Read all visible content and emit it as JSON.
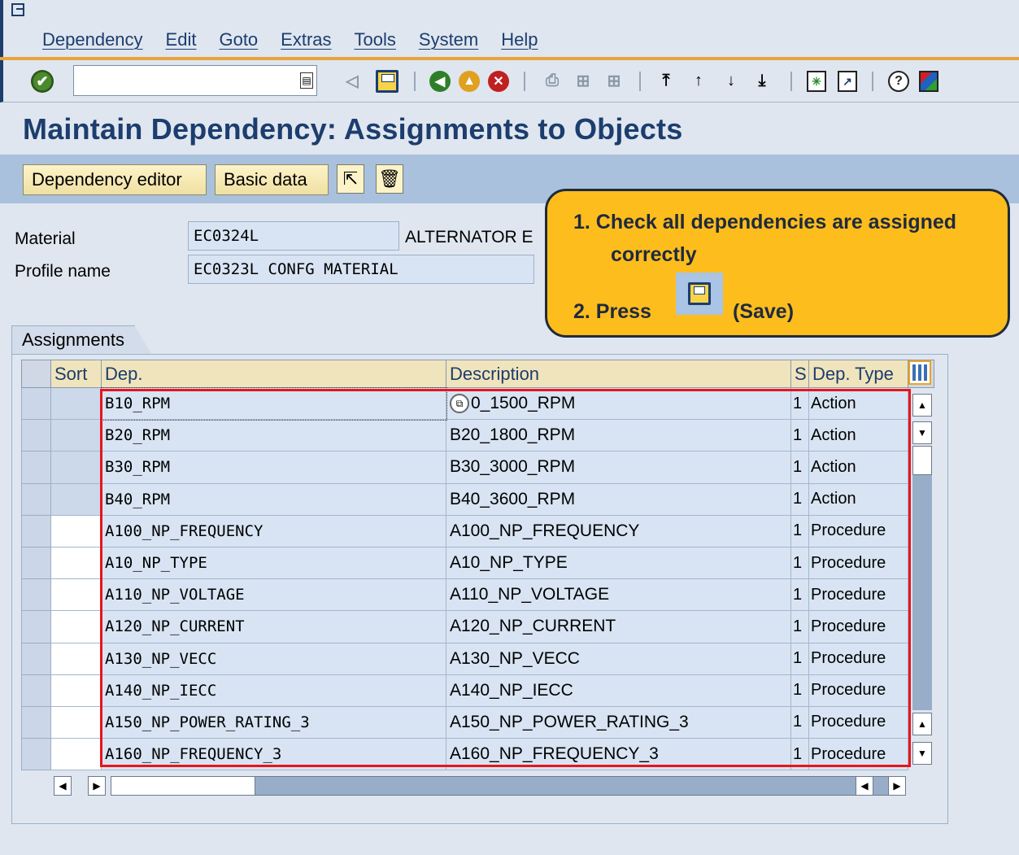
{
  "menu": [
    "Dependency",
    "Edit",
    "Goto",
    "Extras",
    "Tools",
    "System",
    "Help"
  ],
  "toolbar": {
    "command_value": "",
    "icons": [
      "enter-icon",
      "back-icon",
      "save-icon",
      "back-green-icon",
      "exit-icon",
      "cancel-icon",
      "print-icon",
      "find-icon",
      "find-next-icon",
      "first-page-icon",
      "previous-page-icon",
      "next-page-icon",
      "last-page-icon",
      "create-session-icon",
      "shortcut-icon",
      "help-icon",
      "customize-layout-icon"
    ]
  },
  "page_title": "Maintain Dependency: Assignments to Objects",
  "app_toolbar": {
    "dependency_editor": "Dependency editor",
    "basic_data": "Basic data"
  },
  "header": {
    "material_label": "Material",
    "material_value": "EC0324L",
    "material_desc": "ALTERNATOR E",
    "profile_label": "Profile name",
    "profile_value": "EC0323L CONFG MATERIAL"
  },
  "callout": {
    "step1_line1": "1. Check all dependencies are assigned",
    "step1_line2": "correctly",
    "step2_prefix": "2. Press",
    "step2_suffix": "(Save)"
  },
  "assignments": {
    "tab_label": "Assignments",
    "columns": {
      "sort": "Sort",
      "dep": "Dep.",
      "description": "Description",
      "s": "S",
      "dep_type": "Dep. Type"
    },
    "rows": [
      {
        "dep": "B10_RPM",
        "description": "0_1500_RPM",
        "s": "1",
        "type": "Action"
      },
      {
        "dep": "B20_RPM",
        "description": "B20_1800_RPM",
        "s": "1",
        "type": "Action"
      },
      {
        "dep": "B30_RPM",
        "description": "B30_3000_RPM",
        "s": "1",
        "type": "Action"
      },
      {
        "dep": "B40_RPM",
        "description": "B40_3600_RPM",
        "s": "1",
        "type": "Action"
      },
      {
        "dep": "A100_NP_FREQUENCY",
        "description": "A100_NP_FREQUENCY",
        "s": "1",
        "type": "Procedure"
      },
      {
        "dep": "A10_NP_TYPE",
        "description": "A10_NP_TYPE",
        "s": "1",
        "type": "Procedure"
      },
      {
        "dep": "A110_NP_VOLTAGE",
        "description": "A110_NP_VOLTAGE",
        "s": "1",
        "type": "Procedure"
      },
      {
        "dep": "A120_NP_CURRENT",
        "description": "A120_NP_CURRENT",
        "s": "1",
        "type": "Procedure"
      },
      {
        "dep": "A130_NP_VECC",
        "description": "A130_NP_VECC",
        "s": "1",
        "type": "Procedure"
      },
      {
        "dep": "A140_NP_IECC",
        "description": "A140_NP_IECC",
        "s": "1",
        "type": "Procedure"
      },
      {
        "dep": "A150_NP_POWER_RATING_3",
        "description": "A150_NP_POWER_RATING_3",
        "s": "1",
        "type": "Procedure"
      },
      {
        "dep": "A160_NP_FREQUENCY_3",
        "description": "A160_NP_FREQUENCY_3",
        "s": "1",
        "type": "Procedure"
      }
    ]
  },
  "colors": {
    "highlight_box": "#e8151b",
    "callout_bg": "#fdbd1d",
    "title": "#1c3d6e"
  }
}
